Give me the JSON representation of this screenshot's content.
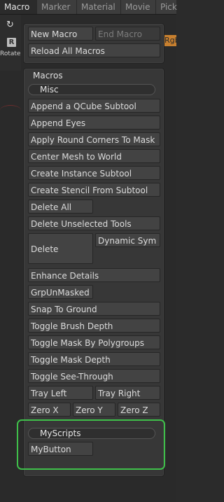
{
  "tabs": [
    "Macro",
    "Marker",
    "Material",
    "Movie",
    "Pick"
  ],
  "left_tools": {
    "rotate_label": "Rotate",
    "r_icon_text": "R"
  },
  "rgb_chip": "Rgb",
  "top_panel": {
    "new_macro": "New Macro",
    "end_macro": "End Macro",
    "reload": "Reload All Macros"
  },
  "macros": {
    "title": "Macros",
    "misc_header": "Misc",
    "items": {
      "append_qcube": "Append a QCube Subtool",
      "append_eyes": "Append Eyes",
      "apply_round": "Apply Round Corners To Mask",
      "center_mesh": "Center Mesh to World",
      "create_instance": "Create Instance Subtool",
      "create_stencil": "Create Stencil From Subtool",
      "delete_all": "Delete All",
      "delete_unselected": "Delete Unselected Tools",
      "delete": "Delete",
      "dynamic_sym": "Dynamic Sym",
      "enhance_details": "Enhance Details",
      "grpunmasked": "GrpUnMasked",
      "snap_ground": "Snap To Ground",
      "toggle_brush_depth": "Toggle Brush Depth",
      "toggle_mask_poly": "Toggle Mask By Polygroups",
      "toggle_mask_depth": "Toggle Mask Depth",
      "toggle_see_through": "Toggle See-Through",
      "tray_left": "Tray Left",
      "tray_right": "Tray Right",
      "zero_x": "Zero X",
      "zero_y": "Zero Y",
      "zero_z": "Zero Z"
    },
    "myscripts_header": "MyScripts",
    "mybutton": "MyButton"
  }
}
